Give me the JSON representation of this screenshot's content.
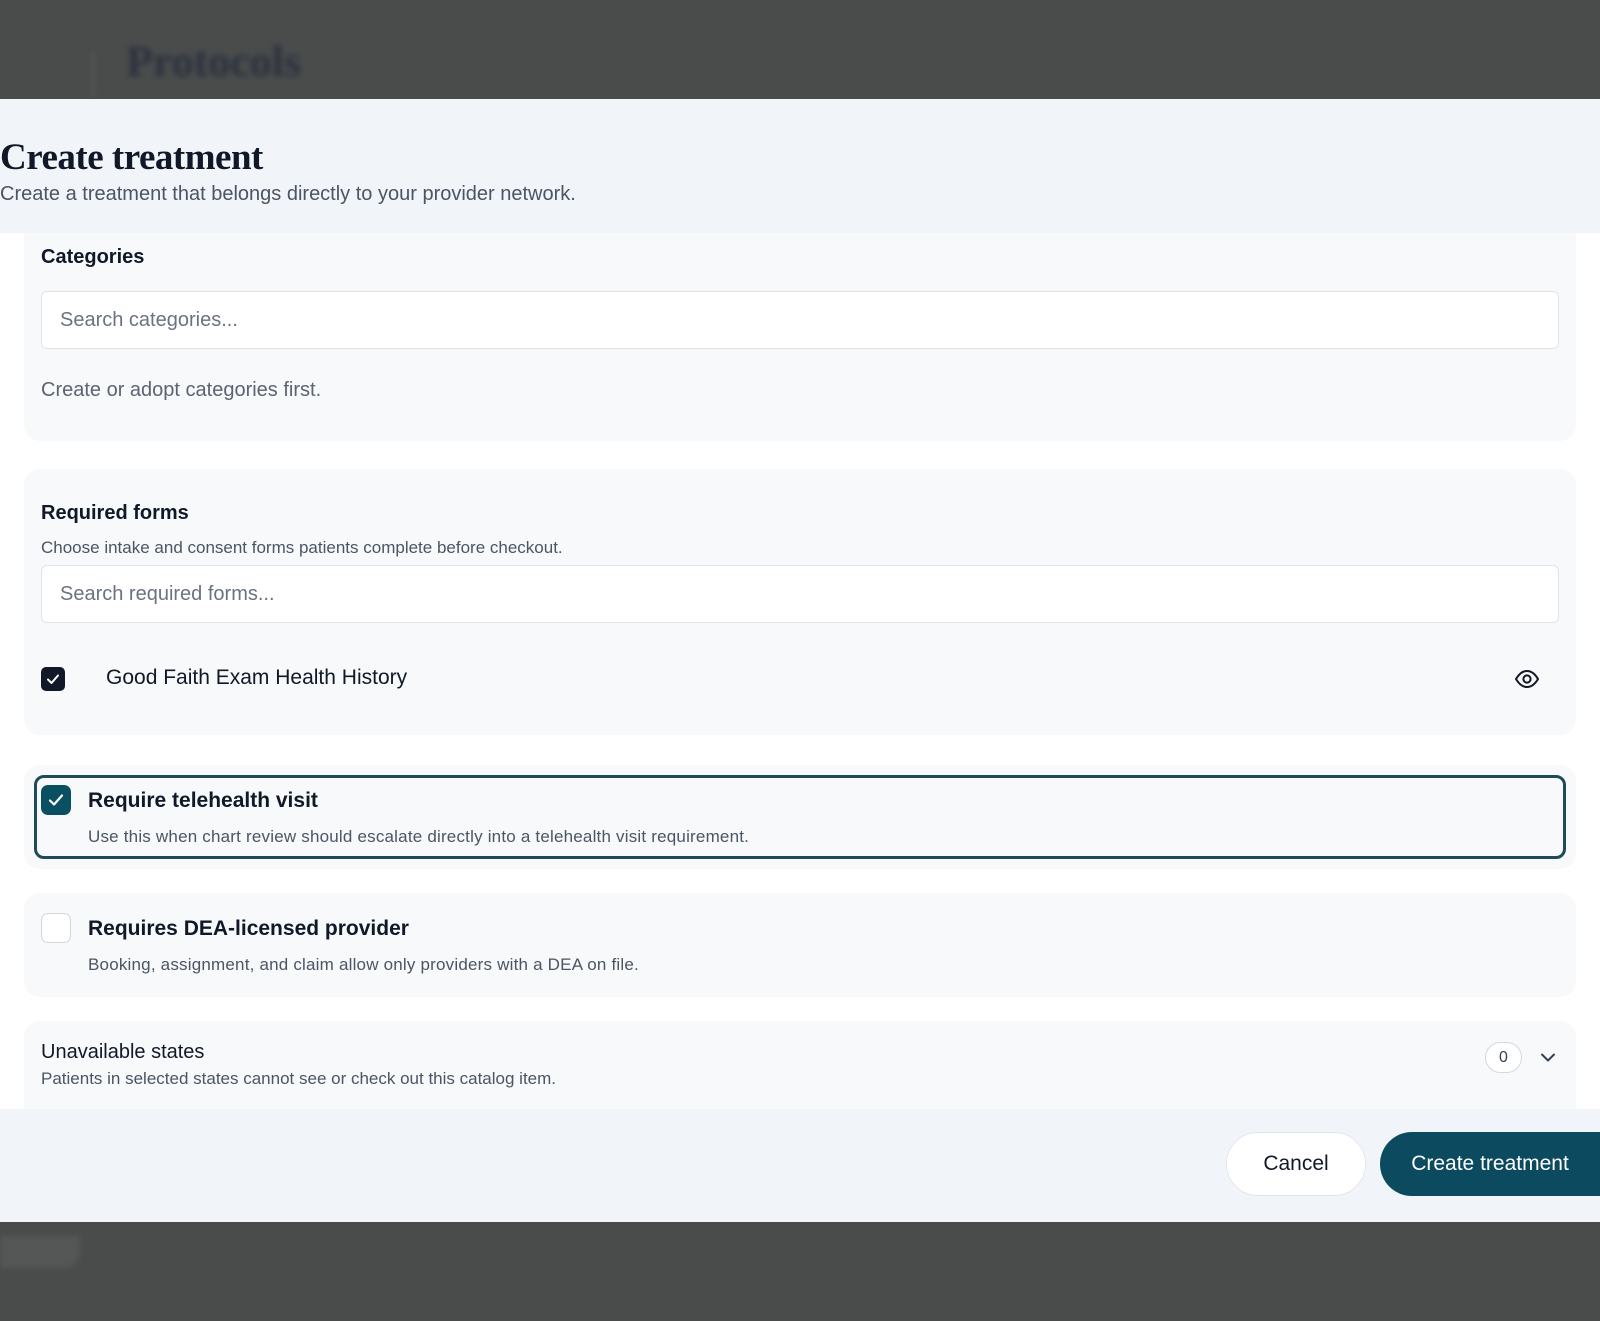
{
  "background": {
    "page_title": "Protocols"
  },
  "modal": {
    "title": "Create treatment",
    "subtitle": "Create a treatment that belongs directly to your provider network."
  },
  "categories": {
    "title": "Categories",
    "search_placeholder": "Search categories...",
    "empty_text": "Create or adopt categories first."
  },
  "required_forms": {
    "title": "Required forms",
    "description": "Choose intake and consent forms patients complete before checkout.",
    "search_placeholder": "Search required forms...",
    "items": [
      {
        "label": "Good Faith Exam Health History",
        "checked": true,
        "icon": "eye-icon"
      }
    ]
  },
  "telehealth": {
    "title": "Require telehealth visit",
    "description": "Use this when chart review should escalate directly into a telehealth visit requirement.",
    "checked": true
  },
  "dea": {
    "title": "Requires DEA-licensed provider",
    "description": "Booking, assignment, and claim allow only providers with a DEA on file.",
    "checked": false
  },
  "unavailable_states": {
    "title": "Unavailable states",
    "description": "Patients in selected states cannot see or check out this catalog item.",
    "count": "0",
    "icon": "chevron-down-icon"
  },
  "footer": {
    "cancel_label": "Cancel",
    "create_label": "Create treatment"
  },
  "colors": {
    "accent": "#0b4a5f",
    "focus_border": "#1e4a5a",
    "backdrop": "#4a4c4c",
    "modal_bg": "#f1f4f8"
  }
}
